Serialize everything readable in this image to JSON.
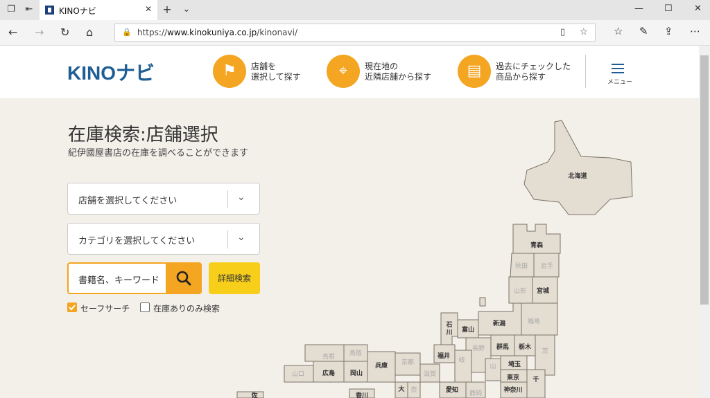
{
  "browser": {
    "tab_title": "KINOナビ",
    "url_prefix": "https://",
    "url_host": "www.kinokuniya.co.jp",
    "url_path": "/kinonavi/"
  },
  "header": {
    "logo_latin": "KINO",
    "logo_kana": "ナビ",
    "nav": [
      {
        "line1": "店舗を",
        "line2": "選択して探す",
        "icon": "map-pin-icon"
      },
      {
        "line1": "現在地の",
        "line2": "近隣店舗から探す",
        "icon": "location-map-icon"
      },
      {
        "line1": "過去にチェックした",
        "line2": "商品から探す",
        "icon": "clipboard-icon"
      }
    ],
    "menu_label": "メニュー"
  },
  "main": {
    "title": "在庫検索:店舗選択",
    "subtitle": "紀伊國屋書店の在庫を調べることができます",
    "store_select": "店舗を選択してください",
    "category_select": "カテゴリを選択してください",
    "search_placeholder": "書籍名、キーワード",
    "detail_search": "詳細検索",
    "safe_search": "セーフサーチ",
    "stock_only": "在庫ありのみ検索"
  },
  "map": {
    "prefectures_bold": [
      "北海道",
      "青森",
      "宮城",
      "石川",
      "富山",
      "新潟",
      "群馬",
      "栃木",
      "福井",
      "埼玉",
      "東京",
      "千葉",
      "神奈川",
      "愛知",
      "兵庫",
      "広島",
      "岡山",
      "香川",
      "大阪",
      "佐"
    ],
    "prefectures_dim": [
      "秋田",
      "岩手",
      "山形",
      "福島",
      "長野",
      "茨城",
      "岐阜",
      "山梨",
      "静岡",
      "滋賀",
      "京都",
      "島根",
      "鳥取",
      "山口",
      "奈良"
    ]
  },
  "colors": {
    "accent": "#f4a521",
    "brand": "#1f5d95",
    "detail_button": "#f7cf1b",
    "page_bg": "#f3f0ea"
  }
}
